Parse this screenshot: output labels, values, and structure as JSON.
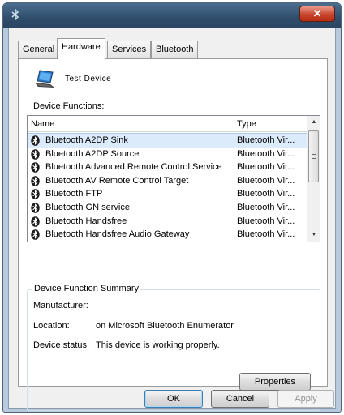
{
  "window": {
    "close_glyph": "✕"
  },
  "tabs": [
    {
      "label": "General"
    },
    {
      "label": "Hardware"
    },
    {
      "label": "Services"
    },
    {
      "label": "Bluetooth"
    }
  ],
  "device": {
    "name": "Test Device",
    "icon": "laptop-icon"
  },
  "functions": {
    "label": "Device Functions:",
    "columns": {
      "name": "Name",
      "type": "Type"
    },
    "rows": [
      {
        "name": "Bluetooth A2DP Sink",
        "type": "Bluetooth Vir..."
      },
      {
        "name": "Bluetooth A2DP Source",
        "type": "Bluetooth Vir..."
      },
      {
        "name": "Bluetooth Advanced Remote Control Service",
        "type": "Bluetooth Vir..."
      },
      {
        "name": "Bluetooth AV Remote Control Target",
        "type": "Bluetooth Vir..."
      },
      {
        "name": "Bluetooth FTP",
        "type": "Bluetooth Vir..."
      },
      {
        "name": "Bluetooth GN service",
        "type": "Bluetooth Vir..."
      },
      {
        "name": "Bluetooth Handsfree",
        "type": "Bluetooth Vir..."
      },
      {
        "name": "Bluetooth Handsfree Audio Gateway",
        "type": "Bluetooth Vir..."
      }
    ]
  },
  "summary": {
    "title": "Device Function Summary",
    "manufacturer_label": "Manufacturer:",
    "manufacturer_value": "",
    "location_label": "Location:",
    "location_value": "on Microsoft Bluetooth Enumerator",
    "status_label": "Device status:",
    "status_value": "This device is working properly.",
    "properties_button": "Properties"
  },
  "buttons": {
    "ok": "OK",
    "cancel": "Cancel",
    "apply": "Apply"
  },
  "colors": {
    "titlebar": "#2f4e6c",
    "selection": "#dcebfc",
    "bluetooth": "#1a1a1a"
  }
}
